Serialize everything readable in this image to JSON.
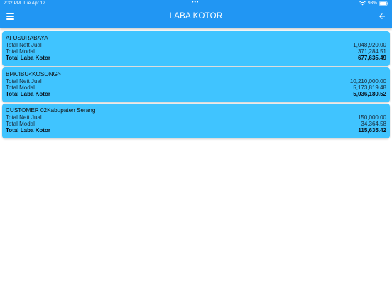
{
  "status": {
    "time": "2:32 PM",
    "date": "Tue Apr 12",
    "dots": "•••",
    "battery": "93%"
  },
  "appbar": {
    "title": "LABA KOTOR",
    "menu_icon": "hamburger-menu-icon",
    "back_icon": "arrow-back-icon"
  },
  "colors": {
    "appbar": "#2196f3",
    "card": "#40c4ff"
  },
  "labels": {
    "nett": "Total Nett Jual",
    "modal": "Total Modal",
    "laba": "Total Laba Kotor"
  },
  "customers": [
    {
      "name": "AFUSURABAYA",
      "nett": "1,048,920.00",
      "modal": "371,284.51",
      "laba": "677,635.49"
    },
    {
      "name": "BPK/IBU<KOSONG>",
      "nett": "10,210,000.00",
      "modal": "5,173,819.48",
      "laba": "5,036,180.52"
    },
    {
      "name": "CUSTOMER 02Kabupaten Serang",
      "nett": "150,000.00",
      "modal": "34,364.58",
      "laba": "115,635.42"
    }
  ]
}
